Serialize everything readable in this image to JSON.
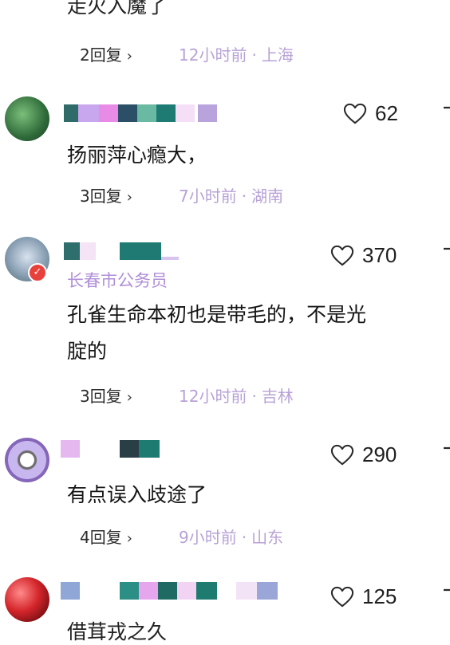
{
  "top_comment": {
    "text_cut": "走火入魔了",
    "replies": "2回复",
    "time": "12小时前",
    "location": "上海"
  },
  "comments": [
    {
      "likes": "62",
      "text": "扬丽萍心瘾大，",
      "replies": "3回复",
      "time": "7小时前",
      "location": "湖南"
    },
    {
      "likes": "370",
      "title": "长春市公务员",
      "text_line1": "孔雀生命本初也是带毛的，不是光",
      "text_line2": "腚的",
      "replies": "3回复",
      "time": "12小时前",
      "location": "吉林"
    },
    {
      "likes": "290",
      "text": "有点误入歧途了",
      "replies": "4回复",
      "time": "9小时前",
      "location": "山东"
    },
    {
      "likes": "125",
      "text_cut": "借茸戎之久"
    }
  ],
  "meta_separator": "·",
  "chevron": "›",
  "colors": {
    "meta": "#b7a2d6",
    "title_tag": "#b08fd8",
    "verified": "#e8413c"
  },
  "icons": {
    "like": "heart-outline-icon",
    "share": "share-icon",
    "chevron": "chevron-right-icon",
    "verified": "verified-badge-icon"
  }
}
